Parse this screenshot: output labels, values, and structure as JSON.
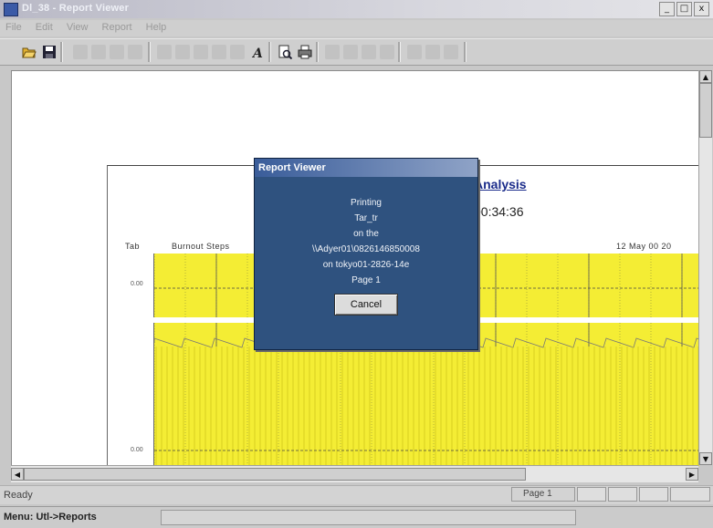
{
  "window": {
    "title": "Dl_38 - Report Viewer",
    "minimize": "_",
    "restore": "□",
    "close": "x"
  },
  "menu": [
    "File",
    "Edit",
    "View",
    "Report",
    "Help"
  ],
  "toolbar": {
    "icons": [
      "open-icon",
      "save-icon",
      "cut-icon",
      "copy-icon",
      "paste-icon",
      "print-setup-icon",
      "find-icon",
      "find-next-icon",
      "zoom-in-icon",
      "zoom-out-icon",
      "fit-icon",
      "font-icon",
      "print-preview-icon",
      "print-icon",
      "first-page-icon",
      "prev-page-icon",
      "next-page-icon",
      "last-page-icon",
      "goto-page-icon",
      "export-icon",
      "options-icon"
    ]
  },
  "report": {
    "title": "Analysis",
    "time": "00:34:36",
    "header_left": "Tab",
    "header_mid": "Burnout Steps",
    "header_date": "12 May 00 20",
    "y_top_label": "0.00",
    "y_bottom_label": "0.00"
  },
  "dialog": {
    "title": "Report Viewer",
    "lines": [
      "Printing",
      "Tar_tr",
      "on the",
      "\\\\Adyer01\\0826146850008",
      "on tokyo01-2826-14e",
      "Page 1"
    ],
    "cancel": "Cancel"
  },
  "status": {
    "ready": "Ready",
    "page": "Page 1",
    "menu_path": "Menu: Utl->Reports"
  },
  "colors": {
    "plot_yellow": "#f4ed34",
    "dialog_blue": "#2f527f",
    "title_link": "#1a2b8a"
  }
}
